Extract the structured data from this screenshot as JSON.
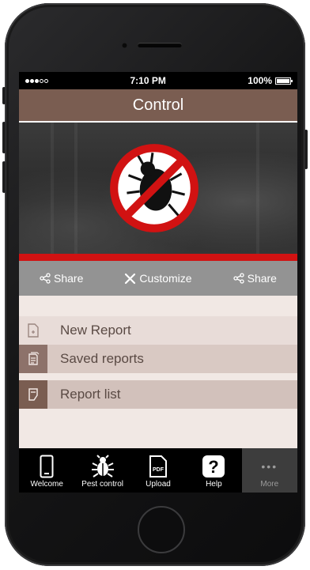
{
  "status_bar": {
    "time": "7:10 PM",
    "battery": "100%"
  },
  "header": {
    "title": "Control"
  },
  "hero": {
    "logo_icon": "no-bugs-icon"
  },
  "action_bar": {
    "share_left": "Share",
    "customize": "Customize",
    "share_right": "Share"
  },
  "menu": {
    "items": [
      {
        "label": "New Report",
        "icon": "new-document-icon"
      },
      {
        "label": "Saved reports",
        "icon": "saved-document-icon"
      },
      {
        "label": "Report list",
        "icon": "report-list-icon"
      }
    ]
  },
  "tabs": [
    {
      "label": "Welcome",
      "icon": "phone-icon"
    },
    {
      "label": "Pest control",
      "icon": "bug-icon"
    },
    {
      "label": "Upload",
      "icon": "pdf-icon",
      "badge": "PDF"
    },
    {
      "label": "Help",
      "icon": "help-icon",
      "glyph": "?"
    },
    {
      "label": "More",
      "icon": "more-icon",
      "glyph": "•••"
    }
  ],
  "colors": {
    "header": "#7a5d51",
    "accent_red": "#d11212",
    "menu_bg": "#f1e8e4"
  }
}
